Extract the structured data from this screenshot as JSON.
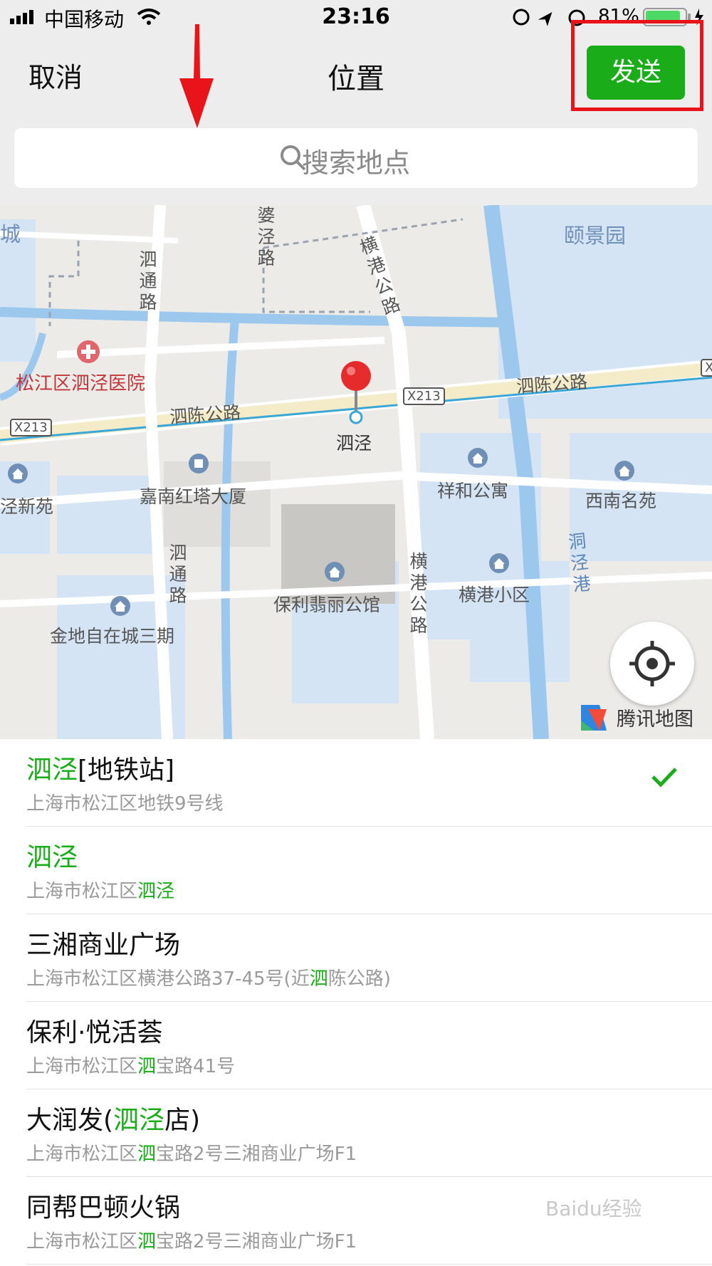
{
  "status_bar": {
    "carrier": "中国移动",
    "time": "23:16",
    "battery": "81%"
  },
  "nav": {
    "cancel": "取消",
    "title": "位置",
    "send": "发送"
  },
  "search": {
    "placeholder": "搜索地点"
  },
  "map": {
    "labels": {
      "songjiang_hospital": "松江区泗泾医院",
      "sichen_road_west": "泗陈公路",
      "sichen_road_east": "泗陈公路",
      "x213_a": "X213",
      "x213_b": "X213",
      "x213_c": "X",
      "sijing": "泗泾",
      "jianan_tower": "嘉南红塔大厦",
      "xianghe": "祥和公寓",
      "xinan": "西南名苑",
      "jing_xinyuan": "泾新苑",
      "baoli_feili": "保利翡丽公馆",
      "henggang_xiaoqu": "横港小区",
      "jindi": "金地自在城三期",
      "yijingyuan": "颐景园",
      "cheng": "城",
      "potang_road": "婆泾路",
      "henggang_road_north": "横港公路",
      "sitong_road_north": "泗通路",
      "sitong_road_south": "泗通路",
      "henggang_road_south": "横港公路",
      "dongjing_gang": "洞泾港"
    },
    "attribution": "腾讯地图"
  },
  "results": [
    {
      "name_hl": "泗泾",
      "name_rest": "[地铁站]",
      "addr_pre": "上海市松江区地铁9号线",
      "addr_hl": "",
      "addr_post": "",
      "selected": true
    },
    {
      "name_hl": "泗泾",
      "name_rest": "",
      "addr_pre": "上海市松江区",
      "addr_hl": "泗泾",
      "addr_post": "",
      "selected": false
    },
    {
      "name_pre": "三湘商业广场",
      "addr_pre": "上海市松江区横港公路37-45号(近",
      "addr_hl": "泗",
      "addr_post": "陈公路)",
      "selected": false
    },
    {
      "name_pre": "保利·悦活荟",
      "addr_pre": "上海市松江区",
      "addr_hl": "泗",
      "addr_post": "宝路41号",
      "selected": false
    },
    {
      "name_pre": "大润发(",
      "name_hl": "泗泾",
      "name_post": "店)",
      "addr_pre": "上海市松江区",
      "addr_hl": "泗",
      "addr_post": "宝路2号三湘商业广场F1",
      "selected": false
    },
    {
      "name_pre": "同帮巴顿火锅",
      "addr_pre": "上海市松江区",
      "addr_hl": "泗",
      "addr_post": "宝路2号三湘商业广场F1",
      "selected": false
    }
  ],
  "watermark": "Baidu经验",
  "colors": {
    "accent": "#1aad19",
    "annotation_red": "#e8141a"
  }
}
